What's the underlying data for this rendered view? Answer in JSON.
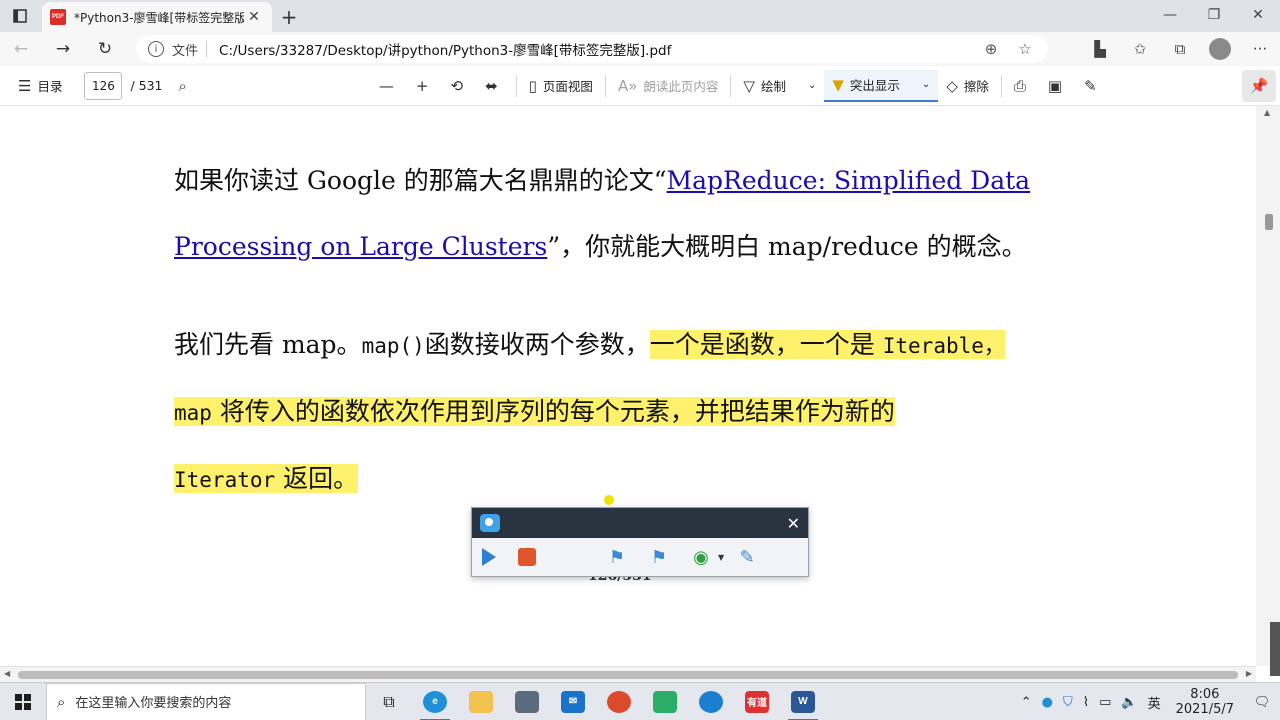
{
  "browser": {
    "tab_title": "*Python3-廖雪峰[带标签完整版]",
    "tab_favicon": "PDF",
    "scheme_label": "文件",
    "url": "C:/Users/33287/Desktop/讲python/Python3-廖雪峰[带标签完整版].pdf"
  },
  "pdf_toolbar": {
    "toc_label": "目录",
    "current_page": "126",
    "total_pages": "/ 531",
    "page_view_label": "页面视图",
    "read_aloud_label": "朗读此页内容",
    "draw_label": "绘制",
    "highlight_label": "突出显示",
    "erase_label": "擦除"
  },
  "document": {
    "p1_line1_text": "如果你读过 Google 的那篇大名鼎鼎的论文“",
    "p1_line1_link": "MapReduce: Simplified Data ",
    "p1_line2_link": "Processing on Large Clusters",
    "p1_line2_text": "”，你就能大概明白 map/reduce 的概念。",
    "p2_line1_a": "我们先看 map。",
    "p2_line1_code": "map()",
    "p2_line1_b": "函数接收两个参数，",
    "p2_line1_hl": "一个是函数，一个是 ",
    "p2_line1_hl_code": "Iterable，",
    "p2_line2_code": "map",
    "p2_line2_text": " 将传入的函数依次作用到序列的每个元素，并把结果作为新的",
    "p2_line3_code": "Iterator",
    "p2_line3_text": " 返回。",
    "page_footer": "126/531"
  },
  "taskbar": {
    "search_placeholder": "在这里输入你要搜索的内容",
    "ime": "英",
    "time": "8:06",
    "date": "2021/5/7",
    "youdao_label": "有道",
    "word_label": "W"
  },
  "colors": {
    "highlight": "#fff16b",
    "link": "#1a0dab",
    "recorder_header": "#2a3340"
  }
}
